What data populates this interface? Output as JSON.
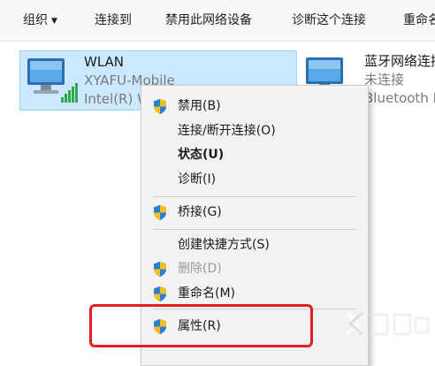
{
  "toolbar": {
    "organize": "组织",
    "connect_to": "连接到",
    "disable_device": "禁用此网络设备",
    "diagnose": "诊断这个连接",
    "rename": "重命名"
  },
  "adapters": [
    {
      "name": "WLAN",
      "line2": "XYAFU-Mobile",
      "line3": "Intel(R) W",
      "icon": "wifi-adapter-icon"
    },
    {
      "name": "蓝牙网络连接",
      "line2": "未连接",
      "line3": "Bluetooth D",
      "icon": "bluetooth-adapter-icon"
    }
  ],
  "context_menu": {
    "disable": "禁用(B)",
    "connect_disconnect": "连接/断开连接(O)",
    "status": "状态(U)",
    "diagnose": "诊断(I)",
    "bridge": "桥接(G)",
    "create_shortcut": "创建快捷方式(S)",
    "delete": "删除(D)",
    "rename": "重命名(M)",
    "properties": "属性(R)"
  },
  "colors": {
    "selection": "#cce8ff",
    "highlight_box": "#e02020",
    "menu_bg": "#f2f2f2"
  }
}
